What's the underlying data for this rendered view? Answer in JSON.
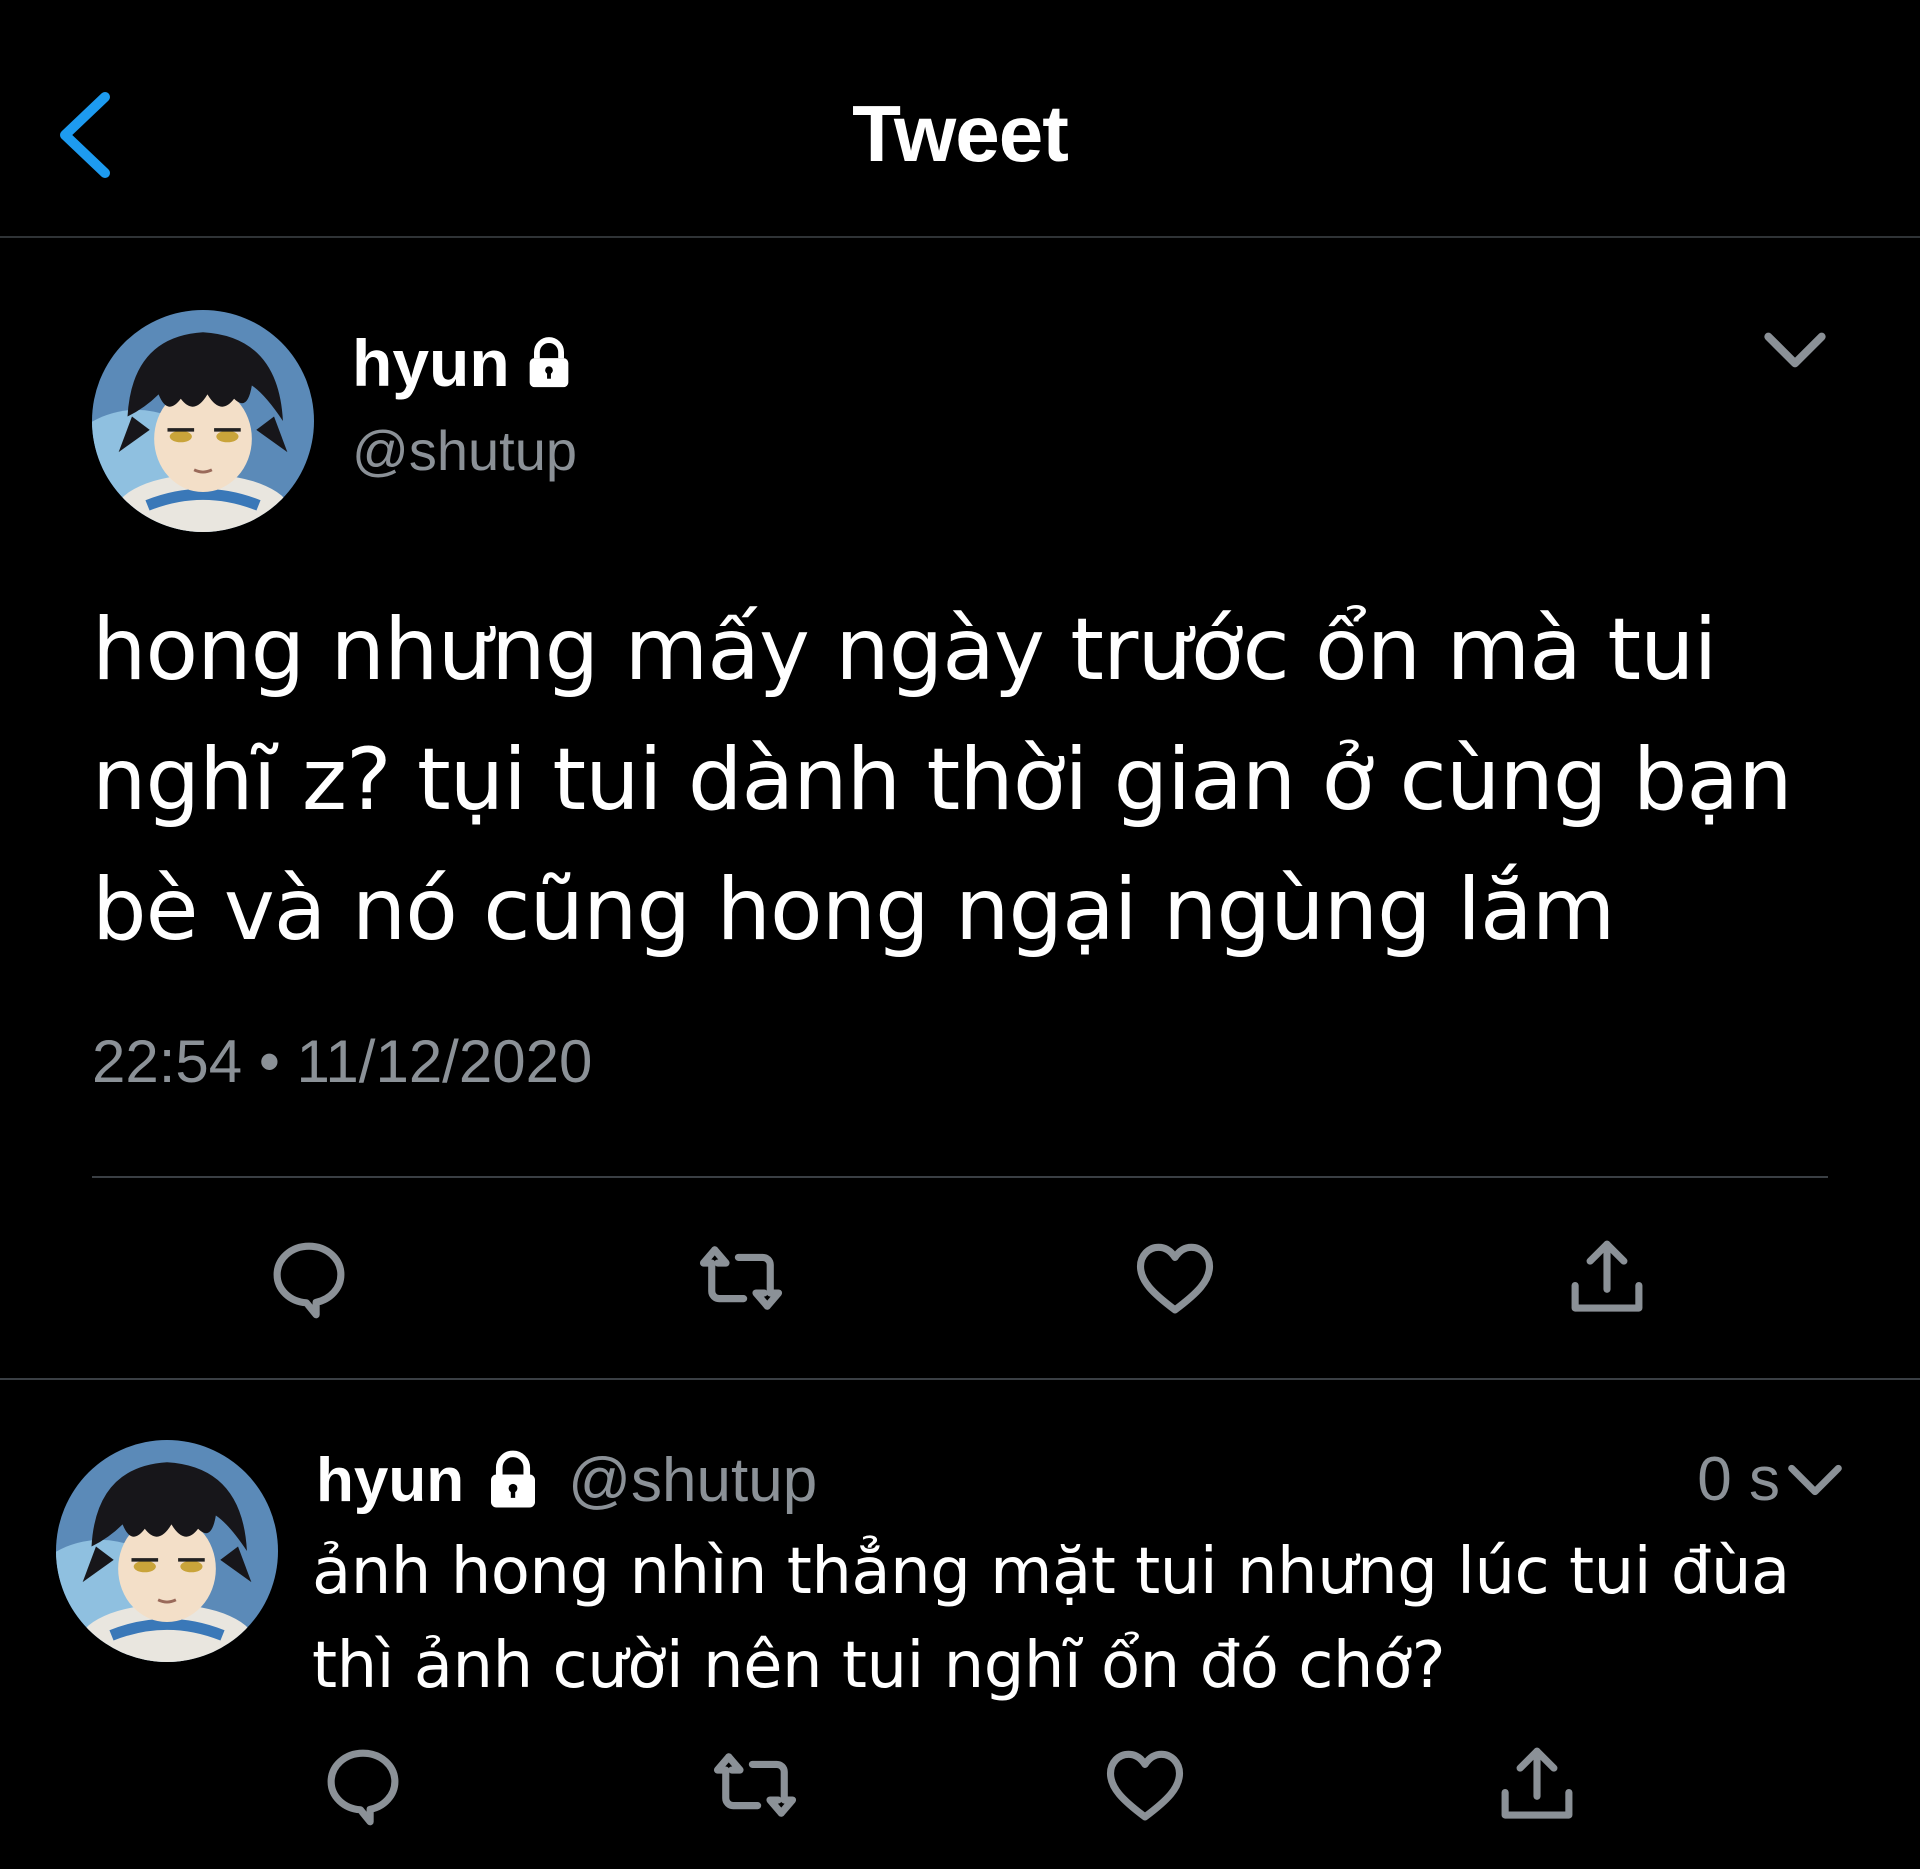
{
  "header": {
    "title": "Tweet"
  },
  "colors": {
    "accent": "#1d9bf0",
    "background": "#000000",
    "secondary_text": "#8b9197",
    "divider": "#2f3336"
  },
  "main_tweet": {
    "author_name": "hyun",
    "handle": "@shutup",
    "locked": true,
    "text": "hong nhưng mấy ngày trước ổn mà tui nghĩ z? tụi tui dành thời gian ở cùng bạn bè và nó cũng hong ngại ngùng lắm",
    "timestamp": "22:54 • 11/12/2020",
    "actions": [
      "reply-icon",
      "retweet-icon",
      "like-icon",
      "share-icon"
    ]
  },
  "reply_tweet": {
    "author_name": "hyun",
    "handle": "@shutup",
    "locked": true,
    "time": "0 s",
    "text": "ảnh hong nhìn thẳng mặt tui nhưng lúc tui đùa thì ảnh cười nên tui nghĩ ổn đó chớ?",
    "actions": [
      "reply-icon",
      "retweet-icon",
      "like-icon",
      "share-icon"
    ]
  }
}
